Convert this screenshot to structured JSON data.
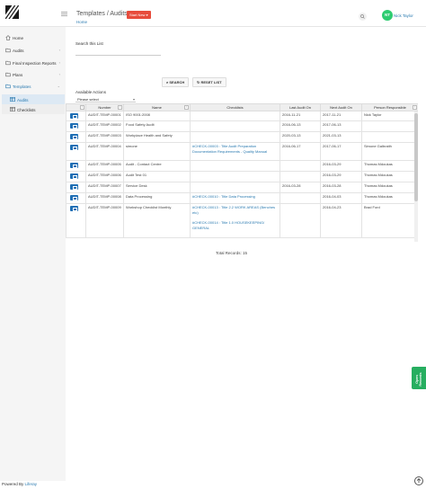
{
  "header": {
    "page_title": "Templates / Audits",
    "start_new_label": "Start New ▾",
    "breadcrumb": "Home",
    "avatar_initials": "NT",
    "user_name": "Nick Taylor"
  },
  "sidebar": {
    "items": [
      {
        "label": "Home",
        "icon": "home-icon"
      },
      {
        "label": "Audits",
        "icon": "folder-icon"
      },
      {
        "label": "Final Inspection Reports",
        "icon": "folder-icon"
      },
      {
        "label": "Plans",
        "icon": "folder-icon"
      },
      {
        "label": "Templates",
        "icon": "folder-icon"
      }
    ],
    "sub_items": [
      {
        "label": "Audits",
        "icon": "grid-icon"
      },
      {
        "label": "Checklists",
        "icon": "grid-icon"
      }
    ]
  },
  "filters": {
    "search_label": "Search this List",
    "search_value": "",
    "search_button": "SEARCH",
    "reset_button": "RESET LIST",
    "actions_label": "Available Actions",
    "actions_selected": "Please select"
  },
  "table": {
    "columns": [
      "Number",
      "Name",
      "Checklists",
      "Last Audit On",
      "Next Audit On",
      "Person Responsible"
    ],
    "rows": [
      {
        "number": "AUDIT-TEMP-00001",
        "name": "ISO 9001:2008",
        "checklists": [],
        "last": "2016-11-21",
        "next": "2017-11-21",
        "person": "Nick Taylor"
      },
      {
        "number": "AUDIT-TEMP-00002",
        "name": "Food Safety Audit",
        "checklists": [],
        "last": "2016-06-13",
        "next": "2017-06-13",
        "person": ""
      },
      {
        "number": "AUDIT-TEMP-00003",
        "name": "Workplace Health and Safety",
        "checklists": [],
        "last": "2020-03-13",
        "next": "2021-03-13",
        "person": ""
      },
      {
        "number": "AUDIT-TEMP-00004",
        "name": "simone",
        "checklists": [
          "#CHECK-00003 : Title Audit Preparation Documentation Requirements - Quality Manual"
        ],
        "last": "2016-06-17",
        "next": "2017-06-17",
        "person": "Simone Galbraith"
      },
      {
        "number": "AUDIT-TEMP-00005",
        "name": "Audit - Contact Centre",
        "checklists": [],
        "last": "",
        "next": "2016-03-29",
        "person": "Thomas Mdoukas"
      },
      {
        "number": "AUDIT-TEMP-00006",
        "name": "Audit Test 01",
        "checklists": [],
        "last": "",
        "next": "2016-03-29",
        "person": "Thomas Mdoukas"
      },
      {
        "number": "AUDIT-TEMP-00007",
        "name": "Service Desk",
        "checklists": [],
        "last": "2016-03-28",
        "next": "2016-03-28",
        "person": "Thomas Mdoukas"
      },
      {
        "number": "AUDIT-TEMP-00008",
        "name": "Data Processing",
        "checklists": [
          "#CHECK-00010 : Title Data Processing"
        ],
        "last": "",
        "next": "2016-04-03",
        "person": "Thomas Mdoukas"
      },
      {
        "number": "AUDIT-TEMP-00009",
        "name": "Workshop Checklist Monthly",
        "checklists": [
          "#CHECK-00013 : Title 2.2 WORK AREAS (Benches etc)",
          "#CHECK-00014 : Title 1.0 HOUSEKEEPING/ GENERAL"
        ],
        "last": "",
        "next": "2016-04-23",
        "person": "Brad Ford"
      }
    ],
    "total_records": "Total Records: 15"
  },
  "side_tab": "Open Records",
  "footer": {
    "prefix": "Powered By ",
    "link": "Liferay"
  },
  "colors": {
    "accent": "#2a7ab0",
    "start_new": "#e74c3c",
    "avatar": "#2ecc71",
    "edit_button": "#1f6fb5",
    "side_tab": "#27ae60"
  }
}
